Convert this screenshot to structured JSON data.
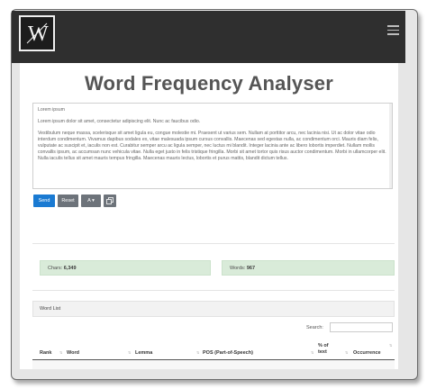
{
  "app": {
    "title": "Word Frequency Analyser",
    "logo_letter": "W"
  },
  "input": {
    "paragraphs": [
      "Lorem ipsum",
      "Lorem ipsum dolor sit amet, consectetur adipiscing elit. Nunc ac faucibus odio.",
      "Vestibulum neque massa, scelerisque sit amet ligula eu, congue molestie mi. Praesent ut varius sem. Nullam at porttitor arcu, nec lacinia nisi. Ut ac dolor vitae odio interdum condimentum. Vivamus dapibus sodales ex, vitae malesuada ipsum cursus convallis. Maecenas sed egestas nulla, ac condimentum orci. Mauris diam felis, vulputate ac suscipit et, iaculis non est. Curabitur semper arcu ac ligula semper, nec luctus mi blandit. Integer lacinia ante ac libero lobortis imperdiet. Nullam mollis convallis ipsum, ac accumsan nunc vehicula vitae. Nulla eget justo in felis tristique fringilla. Morbi sit amet tortor quis risus auctor condimentum. Morbi in ullamcorper elit. Nulla iaculis tellus sit amet mauris tempus fringilla. Maecenas mauris lectus, lobortis et purus mattis, blandit dictum tellus."
    ]
  },
  "toolbar": {
    "send_label": "Send",
    "reset_label": "Reset",
    "font_label": "A ▾",
    "copy_icon": "copy-icon"
  },
  "stats": {
    "chars_label": "Chars:",
    "chars_value": "6,349",
    "words_label": "Words:",
    "words_value": "967"
  },
  "word_list": {
    "heading": "Word List",
    "search_label": "Search:",
    "search_value": "",
    "columns": [
      "Rank",
      "Word",
      "Lemma",
      "POS (Part-of-Speech)",
      "% of text",
      "Occurrence"
    ]
  },
  "colors": {
    "navbar": "#2f2f2f",
    "primary": "#1a7ad2",
    "secondary": "#6d737a",
    "stat_bg": "#d9ebd9"
  }
}
